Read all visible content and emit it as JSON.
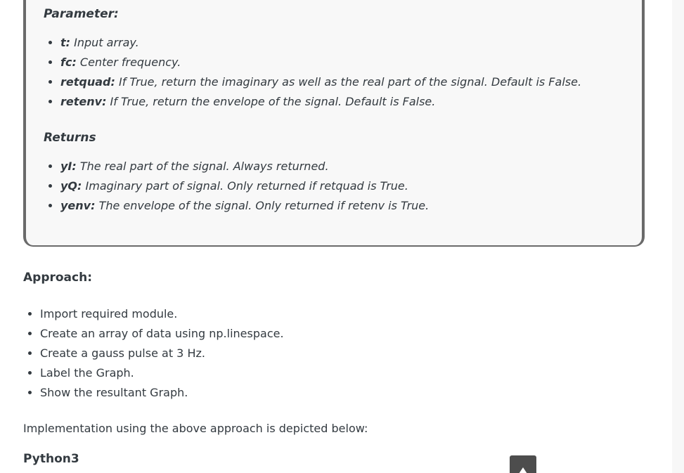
{
  "parameters": {
    "heading": "Parameter:",
    "items": [
      {
        "name": "t:",
        "desc": " Input array."
      },
      {
        "name": "fc:",
        "desc": " Center frequency."
      },
      {
        "name": "retquad:",
        "desc": " If True, return the imaginary as well as the real part of the signal. Default is False."
      },
      {
        "name": "retenv:",
        "desc": " If True, return the envelope of the signal. Default is False."
      }
    ]
  },
  "returns": {
    "heading": "Returns",
    "items": [
      {
        "name": "yI:",
        "desc": " The real part of the signal. Always returned."
      },
      {
        "name": "yQ:",
        "desc": "  Imaginary part of signal. Only returned if retquad is True."
      },
      {
        "name": "yenv:",
        "desc": "  The envelope of the signal. Only returned if retenv is True."
      }
    ]
  },
  "approach": {
    "title": "Approach:",
    "steps": [
      "Import required module.",
      "Create an array of data using np.linespace.",
      "Create a gauss pulse at 3 Hz.",
      "Label the Graph.",
      "Show the resultant Graph."
    ]
  },
  "implementation_text": "Implementation using the above approach is depicted below:",
  "code_language_label": "Python3",
  "back_to_top_icon": "arrow-up-icon"
}
